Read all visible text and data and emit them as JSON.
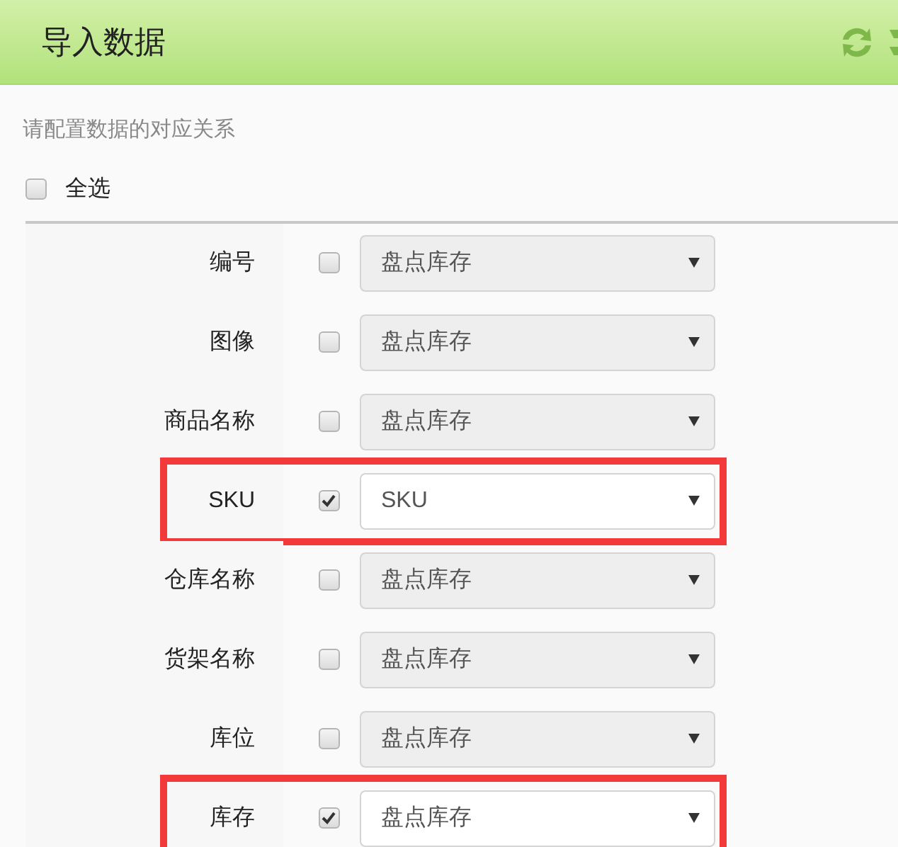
{
  "header": {
    "title": "导入数据"
  },
  "instruction": "请配置数据的对应关系",
  "select_all": {
    "label": "全选",
    "checked": false
  },
  "rows": [
    {
      "label": "编号",
      "checked": false,
      "value": "盘点库存",
      "highlighted": false
    },
    {
      "label": "图像",
      "checked": false,
      "value": "盘点库存",
      "highlighted": false
    },
    {
      "label": "商品名称",
      "checked": false,
      "value": "盘点库存",
      "highlighted": false
    },
    {
      "label": "SKU",
      "checked": true,
      "value": "SKU",
      "highlighted": true
    },
    {
      "label": "仓库名称",
      "checked": false,
      "value": "盘点库存",
      "highlighted": false
    },
    {
      "label": "货架名称",
      "checked": false,
      "value": "盘点库存",
      "highlighted": false
    },
    {
      "label": "库位",
      "checked": false,
      "value": "盘点库存",
      "highlighted": false
    },
    {
      "label": "库存",
      "checked": true,
      "value": "盘点库存",
      "highlighted": true
    }
  ]
}
